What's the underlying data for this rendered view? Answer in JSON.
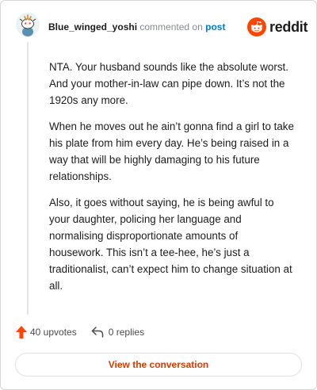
{
  "header": {
    "username": "Blue_winged_yoshi",
    "commented_text": "commented on",
    "post_link": "post",
    "logo_text": "reddit"
  },
  "comment": {
    "paragraphs": [
      "NTA. Your husband sounds like the absolute worst. And your mother-in-law can pipe down. It’s not the 1920s any more.",
      "When he moves out he ain’t gonna find a girl to take his plate from him every day. He’s being raised in a way that will be highly damaging to his future relationships.",
      "Also, it goes without saying, he is being awful to your daughter, policing her language and normalising disproportionate amounts of housework. This isn’t a tee-hee, he’s just a traditionalist, can’t expect him to change situation at all."
    ]
  },
  "footer": {
    "upvotes": "40 upvotes",
    "replies": "0 replies"
  },
  "button": {
    "label": "View the conversation"
  },
  "colors": {
    "brand": "#ff4500",
    "link": "#0079d3",
    "button_text": "#d93a00"
  },
  "icons": {
    "avatar": "snoo-avatar",
    "logo": "reddit-alien-icon",
    "upvote": "upvote-arrow-icon",
    "reply": "reply-arrow-icon"
  }
}
